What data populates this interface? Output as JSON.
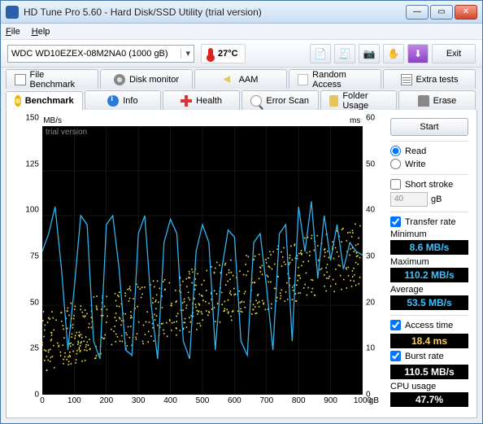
{
  "window": {
    "title": "HD Tune Pro 5.60 - Hard Disk/SSD Utility (trial version)"
  },
  "menu": {
    "file": "File",
    "help": "Help"
  },
  "toolbar": {
    "device": "WDC WD10EZEX-08M2NA0 (1000 gB)",
    "temp": "27°C",
    "exit": "Exit"
  },
  "tabs_row1": [
    {
      "label": "File Benchmark",
      "icon": "ic-file"
    },
    {
      "label": "Disk monitor",
      "icon": "ic-disk"
    },
    {
      "label": "AAM",
      "icon": "ic-aam"
    },
    {
      "label": "Random Access",
      "icon": "ic-rand"
    },
    {
      "label": "Extra tests",
      "icon": "ic-extra"
    }
  ],
  "tabs_row2": [
    {
      "label": "Benchmark",
      "icon": "ic-bench",
      "active": true
    },
    {
      "label": "Info",
      "icon": "ic-info"
    },
    {
      "label": "Health",
      "icon": "ic-health"
    },
    {
      "label": "Error Scan",
      "icon": "ic-scan"
    },
    {
      "label": "Folder Usage",
      "icon": "ic-folder"
    },
    {
      "label": "Erase",
      "icon": "ic-erase"
    }
  ],
  "side": {
    "start": "Start",
    "read": "Read",
    "write": "Write",
    "short_stroke": "Short stroke",
    "short_val": "40",
    "short_unit": "gB",
    "transfer_rate": "Transfer rate",
    "min_label": "Minimum",
    "min_value": "8.6 MB/s",
    "max_label": "Maximum",
    "max_value": "110.2 MB/s",
    "avg_label": "Average",
    "avg_value": "53.5 MB/s",
    "access_label": "Access time",
    "access_value": "18.4 ms",
    "burst_label": "Burst rate",
    "burst_value": "110.5 MB/s",
    "cpu_label": "CPU usage",
    "cpu_value": "47.7%"
  },
  "chart": {
    "watermark": "trial version",
    "y_left_unit": "MB/s",
    "y_right_unit": "ms",
    "x_unit": "gB"
  },
  "chart_data": {
    "type": "line",
    "x_range": [
      0,
      1000
    ],
    "x_ticks": [
      0,
      100,
      200,
      300,
      400,
      500,
      600,
      700,
      800,
      900,
      1000
    ],
    "y_left": {
      "label": "MB/s",
      "range": [
        0,
        150
      ],
      "ticks": [
        0,
        25,
        50,
        75,
        100,
        125,
        150
      ]
    },
    "y_right": {
      "label": "ms",
      "range": [
        0,
        60
      ],
      "ticks": [
        0,
        10,
        20,
        30,
        40,
        50,
        60
      ]
    },
    "series": [
      {
        "name": "Transfer rate (MB/s)",
        "axis": "left",
        "color": "#34b4ef",
        "x": [
          0,
          20,
          40,
          60,
          80,
          100,
          120,
          140,
          160,
          180,
          200,
          220,
          240,
          260,
          280,
          300,
          320,
          340,
          360,
          380,
          400,
          420,
          440,
          460,
          480,
          500,
          520,
          540,
          560,
          580,
          600,
          620,
          640,
          660,
          680,
          700,
          720,
          740,
          760,
          780,
          800,
          820,
          840,
          860,
          880,
          900,
          920,
          940,
          960,
          980,
          1000
        ],
        "y": [
          80,
          90,
          105,
          70,
          25,
          60,
          100,
          95,
          30,
          20,
          95,
          100,
          70,
          25,
          22,
          90,
          100,
          50,
          20,
          85,
          98,
          90,
          30,
          20,
          80,
          95,
          85,
          25,
          70,
          92,
          88,
          30,
          22,
          85,
          90,
          60,
          25,
          90,
          95,
          30,
          105,
          80,
          108,
          65,
          100,
          75,
          95,
          70,
          85,
          80,
          78
        ]
      },
      {
        "name": "Access time (ms)",
        "axis": "right",
        "color": "#e8d84b",
        "style": "scatter",
        "note": "Dense scatter ~8–35 ms trending upward across disk; values estimated from plot."
      }
    ]
  }
}
